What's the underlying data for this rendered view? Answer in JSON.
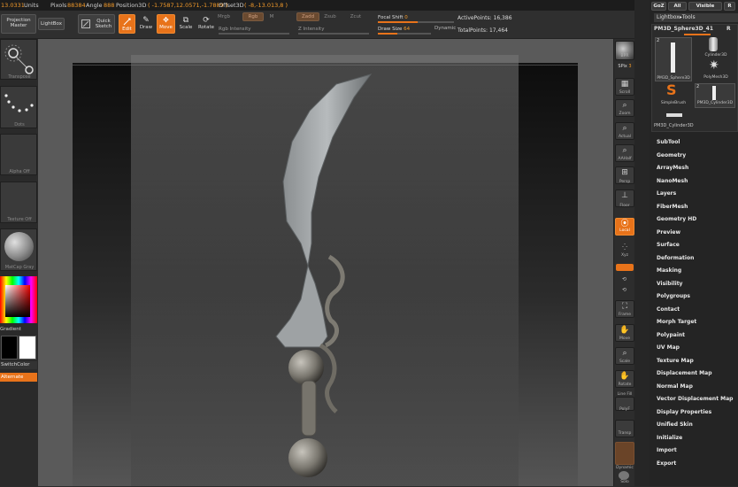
{
  "topbar": {
    "pixols_readout": "13.0331",
    "units_label": "Units",
    "pixols_label": "Pixols",
    "pixols_value": "88384",
    "angle_label": "Angle",
    "angle_value": "888",
    "position_label": "Position3D",
    "position_value": "( -1.7587,12.0571,-1.7889 )",
    "offset_label": "Offset3D",
    "offset_value": "( -8,-13.013,8 )"
  },
  "toolbar": {
    "projection_master": "Projection Master",
    "lightbox": "LightBox",
    "quick_sketch": "Quick Sketch",
    "edit": "Edit",
    "draw": "Draw",
    "move": "Move",
    "scale": "Scale",
    "rotate": "Rotate",
    "mrgb": "Mrgb",
    "rgb": "Rgb",
    "m": "M",
    "zadd": "Zadd",
    "zsub": "Zsub",
    "zcut": "Zcut",
    "rgb_intensity": "Rgb Intensity",
    "z_intensity": "Z Intensity",
    "focal_shift_label": "Focal Shift",
    "focal_shift_value": "0",
    "draw_size_label": "Draw Size",
    "draw_size_value": "64",
    "dynamic": "Dynamic",
    "active_points": "ActivePoints: 16,386",
    "total_points": "TotalPoints: 17,464"
  },
  "left_shelf": {
    "transpose": "Transpose",
    "dots": "Dots",
    "alpha_off": "Alpha Off",
    "texture_off": "Texture Off",
    "matcap": "MatCap Gray",
    "gradient": "Gradient",
    "switch_color": "SwitchColor",
    "alternate": "Alternate"
  },
  "right_shelf": {
    "bpr": "BPR",
    "spix_label": "SPix",
    "spix_value": "3",
    "scroll": "Scroll",
    "zoom": "Zoom",
    "actual": "Actual",
    "aahalf": "AAHalf",
    "persp": "Persp",
    "floor": "Floor",
    "local": "Local",
    "xyz": "Xyz",
    "frame": "Frame",
    "move": "Move",
    "scale": "Scale",
    "rotate": "Rotate",
    "linefill": "Line Fill",
    "polyf": "PolyF",
    "transp": "Transp",
    "dynamic": "Dynamic",
    "solo": "Solo"
  },
  "panel": {
    "tabs": [
      "GoZ",
      "All",
      "Visible",
      "R"
    ],
    "lightbox_tools": "Lightbox▸Tools",
    "tool_name": "PM3D_Sphere3D_41",
    "tool_r": "R",
    "tools": [
      {
        "label": "PM3D_Sphere3D",
        "badge": "2"
      },
      {
        "label": "Cylinder3D",
        "badge": ""
      },
      {
        "label": "PolyMesh3D",
        "badge": ""
      },
      {
        "label": "SimpleBrush",
        "badge": ""
      },
      {
        "label": "PM3D_Cylinder3D",
        "badge": "2"
      }
    ],
    "selected_tool": "PM3D_Cylinder3D",
    "menu_items": [
      "SubTool",
      "Geometry",
      "ArrayMesh",
      "NanoMesh",
      "Layers",
      "FiberMesh",
      "Geometry HD",
      "Preview",
      "Surface",
      "Deformation",
      "Masking",
      "Visibility",
      "Polygroups",
      "Contact",
      "Morph Target",
      "Polypaint",
      "UV Map",
      "Texture Map",
      "Displacement Map",
      "Normal Map",
      "Vector Displacement Map",
      "Display Properties",
      "Unified Skin",
      "Initialize",
      "Import",
      "Export"
    ]
  },
  "colors": {
    "accent": "#e8731a",
    "panel_bg": "#242424",
    "viewport_gray": "#5a5a5a"
  }
}
